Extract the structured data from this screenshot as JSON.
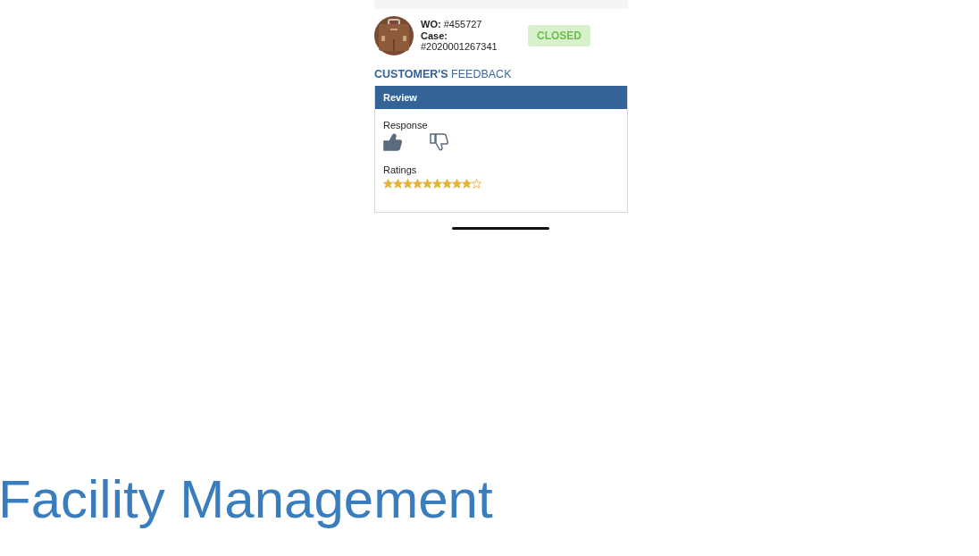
{
  "work_order": {
    "wo_label": "WO:",
    "wo_number": "#455727",
    "case_label": "Case:",
    "case_number": "#2020001267341",
    "status": "CLOSED"
  },
  "feedback": {
    "heading_bold": "CUSTOMER'S",
    "heading_rest": "FEEDBACK",
    "panel_title": "Review",
    "response_label": "Response",
    "responses": [
      {
        "kind": "up",
        "selected": true
      },
      {
        "kind": "down",
        "selected": false
      }
    ],
    "ratings_label": "Ratings",
    "stars": 9
  },
  "caption": "Facility Management"
}
